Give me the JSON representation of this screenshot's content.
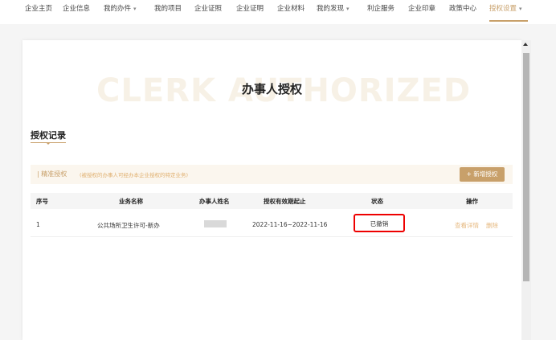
{
  "nav": {
    "items": [
      {
        "label": "企业主页",
        "has_caret": false
      },
      {
        "label": "企业信息",
        "has_caret": false
      },
      {
        "label": "我的办件",
        "has_caret": true
      },
      {
        "label": "我的项目",
        "has_caret": false
      },
      {
        "label": "企业证照",
        "has_caret": false
      },
      {
        "label": "企业证明",
        "has_caret": false
      },
      {
        "label": "企业材料",
        "has_caret": false
      },
      {
        "label": "我的发现",
        "has_caret": true
      },
      {
        "label": "利企服务",
        "has_caret": false
      },
      {
        "label": "企业印章",
        "has_caret": false
      },
      {
        "label": "政策中心",
        "has_caret": false
      },
      {
        "label": "授权设置",
        "has_caret": true,
        "active": true
      }
    ],
    "caret": "▾",
    "accent_color": "#c8a06a"
  },
  "page": {
    "watermark": "CLERK AUTHORIZED",
    "title": "办事人授权"
  },
  "section": {
    "title": "授权记录"
  },
  "toolbar": {
    "label": "| 精准授权",
    "hint": "(被授权的办事人可经办本企业授权的特定业务)",
    "add_button": "+ 新增授权"
  },
  "table": {
    "headers": [
      "序号",
      "业务名称",
      "办事人姓名",
      "授权有效期起止",
      "状态",
      "操作"
    ],
    "rows": [
      {
        "index": "1",
        "business": "公共场所卫生许可-新办",
        "name_masked": true,
        "period": "2022-11-16~2022-11-16",
        "status": "已撤销",
        "actions": [
          "查看详情",
          "删除"
        ]
      }
    ]
  }
}
